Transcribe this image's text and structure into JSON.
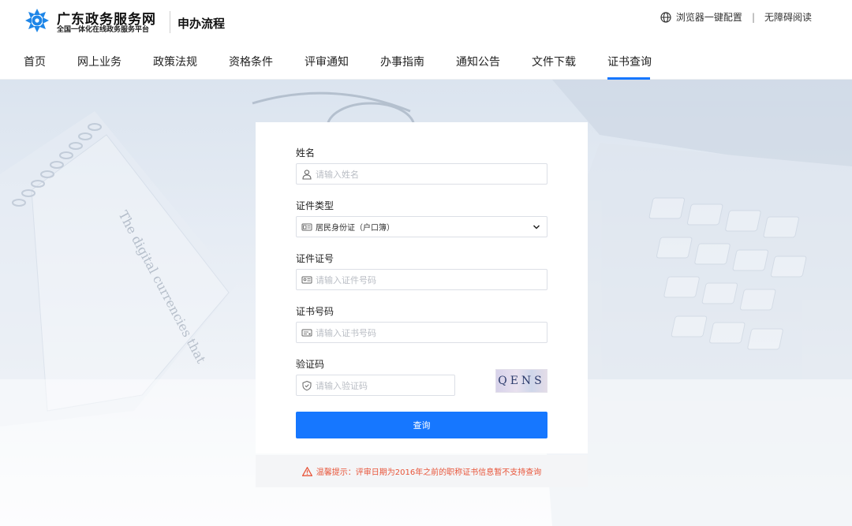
{
  "header": {
    "site_title": "广东政务服务网",
    "site_subtitle": "全国一体化在线政务服务平台",
    "section_title": "申办流程",
    "links": {
      "browser_config": "浏览器一键配置",
      "separator": "|",
      "accessibility": "无障碍阅读"
    }
  },
  "nav": {
    "items": [
      {
        "label": "首页"
      },
      {
        "label": "网上业务"
      },
      {
        "label": "政策法规"
      },
      {
        "label": "资格条件"
      },
      {
        "label": "评审通知"
      },
      {
        "label": "办事指南"
      },
      {
        "label": "通知公告"
      },
      {
        "label": "文件下载"
      },
      {
        "label": "证书查询"
      }
    ],
    "active": "证书查询"
  },
  "banner": {
    "background_text": "The digital currencies that"
  },
  "form": {
    "name": {
      "label": "姓名",
      "placeholder": "请输入姓名",
      "icon": "user-icon"
    },
    "id_type": {
      "label": "证件类型",
      "value": "居民身份证（户口簿）",
      "icon": "id-card-icon"
    },
    "id_number": {
      "label": "证件证号",
      "placeholder": "请输入证件号码",
      "icon": "id-card-icon"
    },
    "cert_number": {
      "label": "证书号码",
      "placeholder": "请输入证书号码",
      "icon": "certificate-icon"
    },
    "captcha": {
      "label": "验证码",
      "placeholder": "请输入验证码",
      "icon": "shield-icon",
      "image_text": "QENS"
    },
    "submit_label": "查询"
  },
  "notice": {
    "text": "温馨提示：评审日期为2016年之前的职称证书信息暂不支持查询",
    "icon": "warning-icon"
  },
  "colors": {
    "accent": "#1677ff",
    "warning": "#e8553a",
    "logo": "#1e86e8"
  }
}
